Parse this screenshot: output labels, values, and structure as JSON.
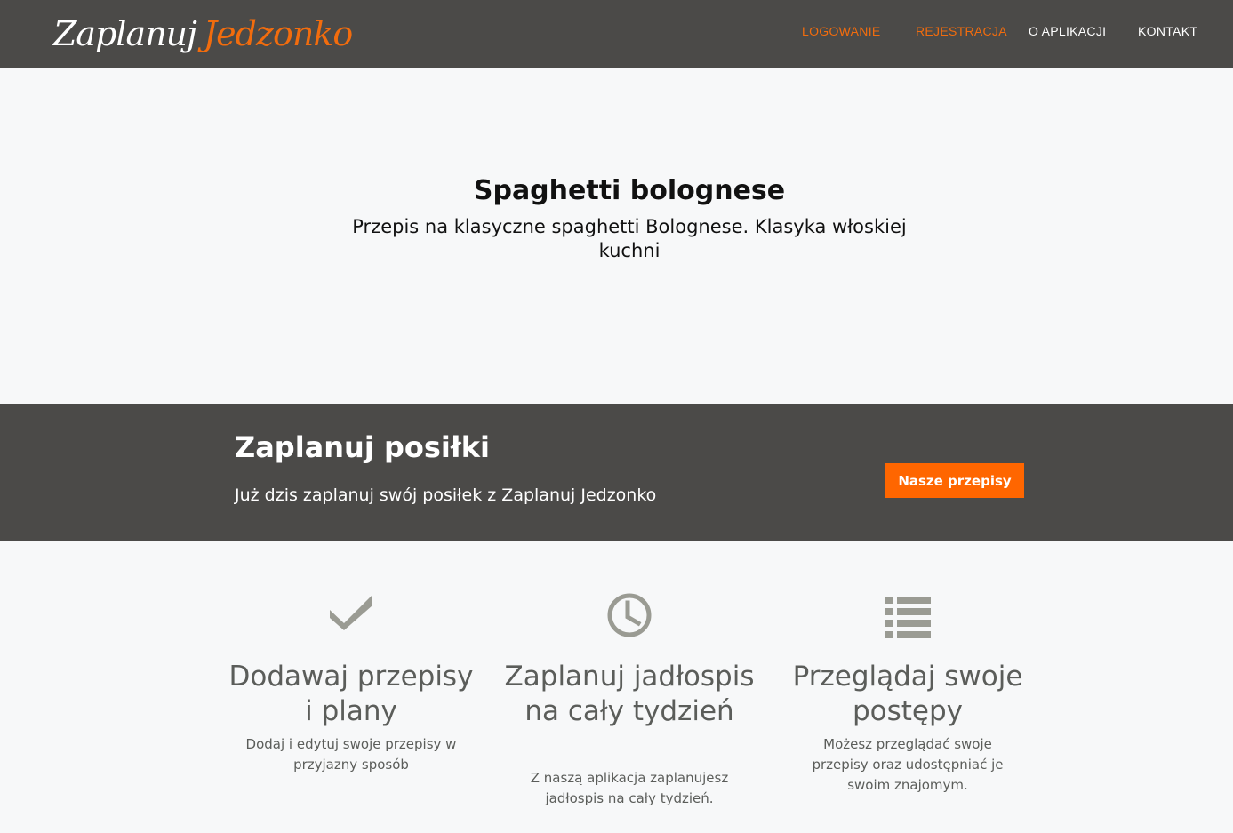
{
  "navbar": {
    "logo_part1": "Zaplanuj",
    "logo_part2": "Jedzonko",
    "items": [
      "LOGOWANIE",
      "REJESTRACJA",
      "O APLIKACJI",
      "KONTAKT"
    ]
  },
  "hero": {
    "title": "Spaghetti bolognese",
    "subtitle": "Przepis na klasyczne spaghetti Bolognese. Klasyka włoskiej kuchni"
  },
  "band": {
    "title": "Zaplanuj posiłki",
    "text": "Już dzis zaplanuj swój posiłek z Zaplanuj Jedzonko",
    "button": "Nasze przepisy"
  },
  "features": [
    {
      "icon": "check-icon",
      "title": "Dodawaj przepisy i plany",
      "description": "Dodaj i edytuj swoje przepisy w przyjazny sposób"
    },
    {
      "icon": "clock-icon",
      "title": "Zaplanuj jadłospis na cały tydzień",
      "description": "Z naszą aplikacja zaplanujesz jadłospis na cały tydzień."
    },
    {
      "icon": "list-icon",
      "title": "Przeglądaj swoje postępy",
      "description": "Możesz przeglądać swoje przepisy oraz udostępniać je swoim znajomym."
    }
  ],
  "colors": {
    "dark": "#4b4a48",
    "accent": "#f26c0d",
    "button": "#ff6600",
    "icon": "#9a9b93",
    "background": "#f7f8f9"
  }
}
